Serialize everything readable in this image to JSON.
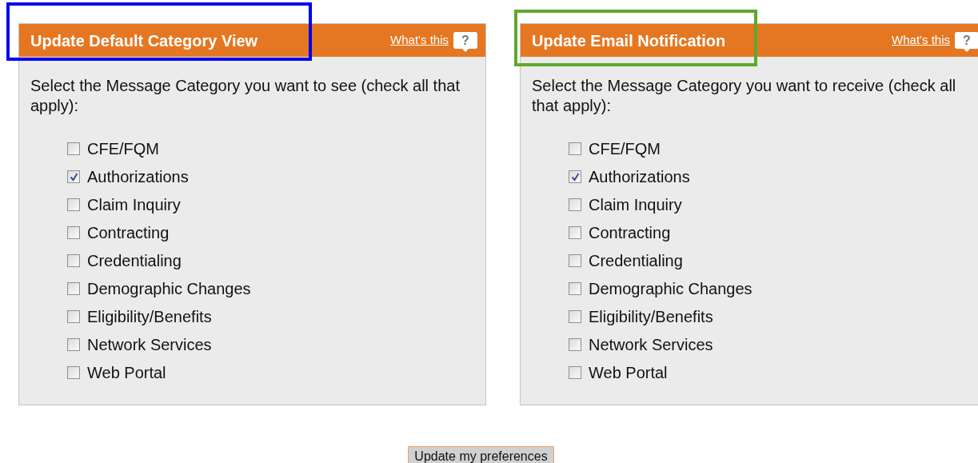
{
  "panels": [
    {
      "title": "Update Default Category View",
      "help_link": "What's this",
      "help_icon": "?",
      "color": "#0000ee",
      "prompt": "Select the Message Category you want to see (check all that apply):",
      "options": [
        {
          "label": "CFE/FQM",
          "checked": false
        },
        {
          "label": "Authorizations",
          "checked": true
        },
        {
          "label": "Claim Inquiry",
          "checked": false
        },
        {
          "label": "Contracting",
          "checked": false
        },
        {
          "label": "Credentialing",
          "checked": false
        },
        {
          "label": "Demographic Changes",
          "checked": false
        },
        {
          "label": "Eligibility/Benefits",
          "checked": false
        },
        {
          "label": "Network Services",
          "checked": false
        },
        {
          "label": "Web Portal",
          "checked": false
        }
      ]
    },
    {
      "title": "Update Email Notification",
      "help_link": "What's this",
      "help_icon": "?",
      "color": "#5fa82e",
      "prompt": "Select the Message Category you want to receive (check all that apply):",
      "options": [
        {
          "label": "CFE/FQM",
          "checked": false
        },
        {
          "label": "Authorizations",
          "checked": true
        },
        {
          "label": "Claim Inquiry",
          "checked": false
        },
        {
          "label": "Contracting",
          "checked": false
        },
        {
          "label": "Credentialing",
          "checked": false
        },
        {
          "label": "Demographic Changes",
          "checked": false
        },
        {
          "label": "Eligibility/Benefits",
          "checked": false
        },
        {
          "label": "Network Services",
          "checked": false
        },
        {
          "label": "Web Portal",
          "checked": false
        }
      ]
    }
  ],
  "submit_button": "Update my preferences"
}
